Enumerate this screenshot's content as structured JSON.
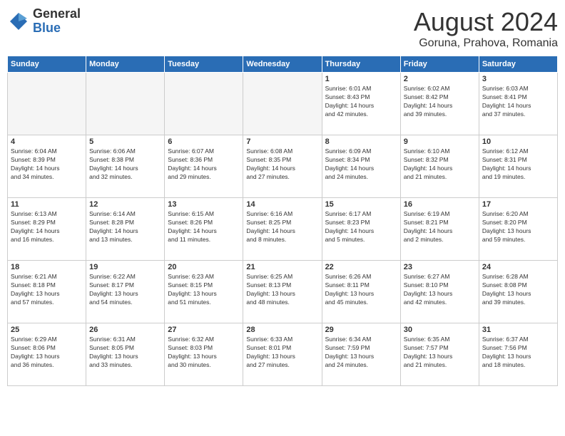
{
  "header": {
    "logo_general": "General",
    "logo_blue": "Blue",
    "month_title": "August 2024",
    "location": "Goruna, Prahova, Romania"
  },
  "weekdays": [
    "Sunday",
    "Monday",
    "Tuesday",
    "Wednesday",
    "Thursday",
    "Friday",
    "Saturday"
  ],
  "weeks": [
    [
      {
        "day": "",
        "info": "",
        "empty": true
      },
      {
        "day": "",
        "info": "",
        "empty": true
      },
      {
        "day": "",
        "info": "",
        "empty": true
      },
      {
        "day": "",
        "info": "",
        "empty": true
      },
      {
        "day": "1",
        "info": "Sunrise: 6:01 AM\nSunset: 8:43 PM\nDaylight: 14 hours\nand 42 minutes."
      },
      {
        "day": "2",
        "info": "Sunrise: 6:02 AM\nSunset: 8:42 PM\nDaylight: 14 hours\nand 39 minutes."
      },
      {
        "day": "3",
        "info": "Sunrise: 6:03 AM\nSunset: 8:41 PM\nDaylight: 14 hours\nand 37 minutes."
      }
    ],
    [
      {
        "day": "4",
        "info": "Sunrise: 6:04 AM\nSunset: 8:39 PM\nDaylight: 14 hours\nand 34 minutes."
      },
      {
        "day": "5",
        "info": "Sunrise: 6:06 AM\nSunset: 8:38 PM\nDaylight: 14 hours\nand 32 minutes."
      },
      {
        "day": "6",
        "info": "Sunrise: 6:07 AM\nSunset: 8:36 PM\nDaylight: 14 hours\nand 29 minutes."
      },
      {
        "day": "7",
        "info": "Sunrise: 6:08 AM\nSunset: 8:35 PM\nDaylight: 14 hours\nand 27 minutes."
      },
      {
        "day": "8",
        "info": "Sunrise: 6:09 AM\nSunset: 8:34 PM\nDaylight: 14 hours\nand 24 minutes."
      },
      {
        "day": "9",
        "info": "Sunrise: 6:10 AM\nSunset: 8:32 PM\nDaylight: 14 hours\nand 21 minutes."
      },
      {
        "day": "10",
        "info": "Sunrise: 6:12 AM\nSunset: 8:31 PM\nDaylight: 14 hours\nand 19 minutes."
      }
    ],
    [
      {
        "day": "11",
        "info": "Sunrise: 6:13 AM\nSunset: 8:29 PM\nDaylight: 14 hours\nand 16 minutes."
      },
      {
        "day": "12",
        "info": "Sunrise: 6:14 AM\nSunset: 8:28 PM\nDaylight: 14 hours\nand 13 minutes."
      },
      {
        "day": "13",
        "info": "Sunrise: 6:15 AM\nSunset: 8:26 PM\nDaylight: 14 hours\nand 11 minutes."
      },
      {
        "day": "14",
        "info": "Sunrise: 6:16 AM\nSunset: 8:25 PM\nDaylight: 14 hours\nand 8 minutes."
      },
      {
        "day": "15",
        "info": "Sunrise: 6:17 AM\nSunset: 8:23 PM\nDaylight: 14 hours\nand 5 minutes."
      },
      {
        "day": "16",
        "info": "Sunrise: 6:19 AM\nSunset: 8:21 PM\nDaylight: 14 hours\nand 2 minutes."
      },
      {
        "day": "17",
        "info": "Sunrise: 6:20 AM\nSunset: 8:20 PM\nDaylight: 13 hours\nand 59 minutes."
      }
    ],
    [
      {
        "day": "18",
        "info": "Sunrise: 6:21 AM\nSunset: 8:18 PM\nDaylight: 13 hours\nand 57 minutes."
      },
      {
        "day": "19",
        "info": "Sunrise: 6:22 AM\nSunset: 8:17 PM\nDaylight: 13 hours\nand 54 minutes."
      },
      {
        "day": "20",
        "info": "Sunrise: 6:23 AM\nSunset: 8:15 PM\nDaylight: 13 hours\nand 51 minutes."
      },
      {
        "day": "21",
        "info": "Sunrise: 6:25 AM\nSunset: 8:13 PM\nDaylight: 13 hours\nand 48 minutes."
      },
      {
        "day": "22",
        "info": "Sunrise: 6:26 AM\nSunset: 8:11 PM\nDaylight: 13 hours\nand 45 minutes."
      },
      {
        "day": "23",
        "info": "Sunrise: 6:27 AM\nSunset: 8:10 PM\nDaylight: 13 hours\nand 42 minutes."
      },
      {
        "day": "24",
        "info": "Sunrise: 6:28 AM\nSunset: 8:08 PM\nDaylight: 13 hours\nand 39 minutes."
      }
    ],
    [
      {
        "day": "25",
        "info": "Sunrise: 6:29 AM\nSunset: 8:06 PM\nDaylight: 13 hours\nand 36 minutes."
      },
      {
        "day": "26",
        "info": "Sunrise: 6:31 AM\nSunset: 8:05 PM\nDaylight: 13 hours\nand 33 minutes."
      },
      {
        "day": "27",
        "info": "Sunrise: 6:32 AM\nSunset: 8:03 PM\nDaylight: 13 hours\nand 30 minutes."
      },
      {
        "day": "28",
        "info": "Sunrise: 6:33 AM\nSunset: 8:01 PM\nDaylight: 13 hours\nand 27 minutes."
      },
      {
        "day": "29",
        "info": "Sunrise: 6:34 AM\nSunset: 7:59 PM\nDaylight: 13 hours\nand 24 minutes."
      },
      {
        "day": "30",
        "info": "Sunrise: 6:35 AM\nSunset: 7:57 PM\nDaylight: 13 hours\nand 21 minutes."
      },
      {
        "day": "31",
        "info": "Sunrise: 6:37 AM\nSunset: 7:56 PM\nDaylight: 13 hours\nand 18 minutes."
      }
    ]
  ]
}
